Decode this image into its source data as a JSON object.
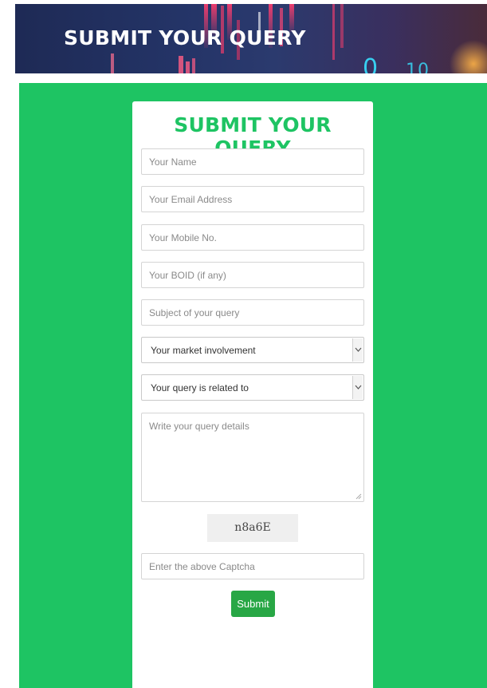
{
  "banner": {
    "title": "SUBMIT YOUR QUERY"
  },
  "form": {
    "title": "SUBMIT YOUR QUERY",
    "name_placeholder": "Your Name",
    "email_placeholder": "Your Email Address",
    "mobile_placeholder": "Your Mobile No.",
    "boid_placeholder": "Your BOID (if any)",
    "subject_placeholder": "Subject of your query",
    "involvement_selected": "Your market involvement",
    "related_selected": "Your query is related to",
    "details_placeholder": "Write your query details",
    "captcha_text": "n8a6E",
    "captcha_placeholder": "Enter the above Captcha",
    "submit_label": "Submit"
  },
  "colors": {
    "accent_green": "#1ec463",
    "submit_green": "#28a745",
    "banner_navy": "#1e2a55"
  },
  "icons": {
    "select_arrow": "chevron-down-icon",
    "textarea_grip": "resize-grip-icon"
  }
}
